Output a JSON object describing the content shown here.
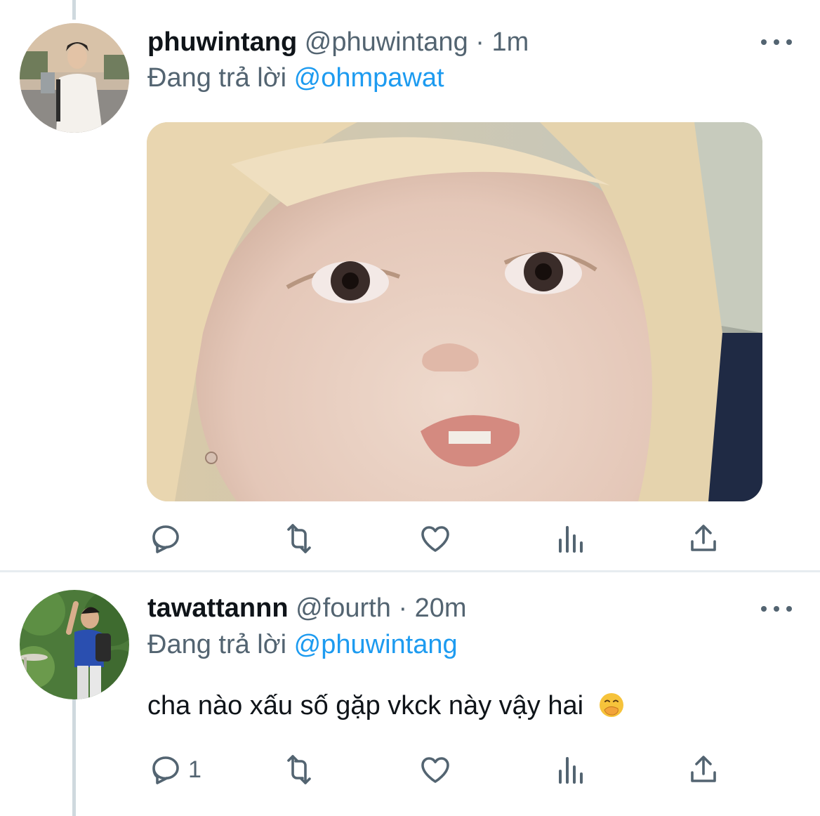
{
  "tweets": [
    {
      "display_name": "phuwintang",
      "handle": "@phuwintang",
      "separator": "·",
      "time": "1m",
      "reply_prefix": "Đang trả lời",
      "reply_to": "@ohmpawat",
      "has_media": true,
      "actions": {
        "reply_count": "",
        "retweet_count": "",
        "like_count": ""
      }
    },
    {
      "display_name": "tawattannn",
      "handle": "@fourth",
      "separator": "·",
      "time": "20m",
      "reply_prefix": "Đang trả lời",
      "reply_to": "@phuwintang",
      "text": "cha nào xấu số gặp vkck này vậy hai",
      "emoji": "face-with-hand-over-mouth",
      "actions": {
        "reply_count": "1",
        "retweet_count": "",
        "like_count": ""
      }
    }
  ],
  "colors": {
    "link": "#1d9bf0",
    "secondary_text": "#536471",
    "primary_text": "#0f1419",
    "thread_line": "#cfd9de"
  }
}
